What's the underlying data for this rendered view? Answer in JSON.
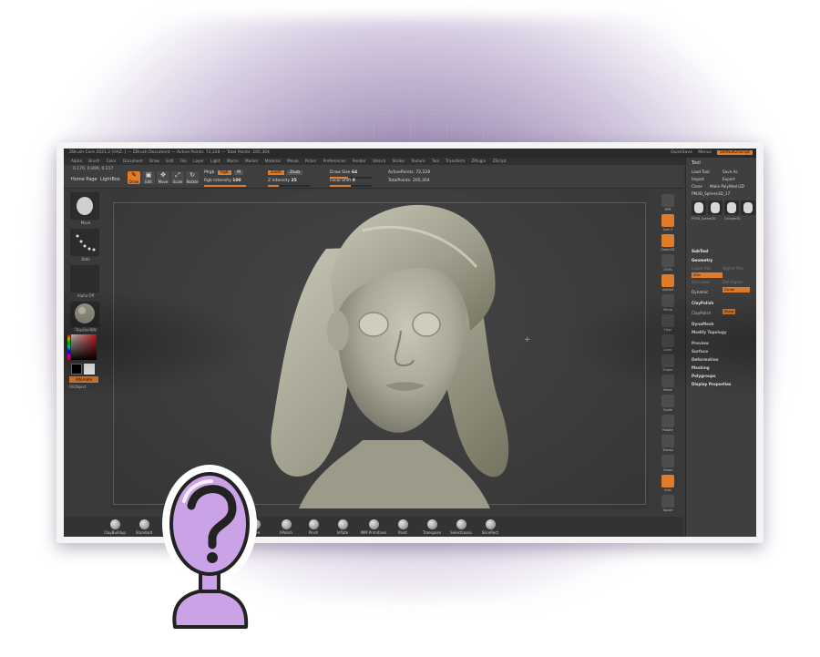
{
  "app": {
    "title_bar": "ZBrush Core 2021.2 [HAZ..] — ZBrush Document — Active Points: 72,228 — Total Points: 205,304",
    "title_right": [
      "QuickSave",
      "Menus",
      "DefaultZScript"
    ],
    "menu": [
      "Alpha",
      "Brush",
      "Color",
      "Document",
      "Draw",
      "Edit",
      "File",
      "Layer",
      "Light",
      "Macro",
      "Marker",
      "Material",
      "Movie",
      "Picker",
      "Preferences",
      "Render",
      "Stencil",
      "Stroke",
      "Texture",
      "Tool",
      "Transform",
      "ZPlugin",
      "ZScript"
    ]
  },
  "toolbar": {
    "coordinates": "0.176, 0.899, 0.217",
    "home_page": "Home Page",
    "lightbox": "LightBox",
    "buttons": [
      "Draw",
      "Edit",
      "Move",
      "Scale",
      "Rotate"
    ],
    "mrgb": "Mrgb",
    "rgb": "Rgb",
    "m": "M",
    "rgb_intensity_label": "Rgb Intensity",
    "rgb_intensity_value": "100",
    "zadd": "Zadd",
    "zsub": "Zsub",
    "z_intensity_label": "Z Intensity",
    "z_intensity_value": "25",
    "draw_size_label": "Draw Size",
    "draw_size_value": "64",
    "focal_shift_label": "Focal Shift",
    "focal_shift_value": "0",
    "active_points": "ActivePoints: 72,228",
    "total_points": "TotalPoints: 205,304"
  },
  "left_shelf": {
    "brush_label": "Move",
    "stroke_label": "Dots",
    "alpha_label": "Alpha Off",
    "texture_label": "Texture Off",
    "material_label": "Clay BuildUp",
    "alternate": "Alternate",
    "fill": "FillObject"
  },
  "right_shelf": [
    "BPR",
    "Spix 3",
    "Zoom2D",
    "100%",
    "AAHalf",
    "Persp",
    "Floor",
    "Local",
    "Frame",
    "Move",
    "Scale",
    "Rotate",
    "Transp",
    "Ghost",
    "Solo",
    "Xpose"
  ],
  "palette": {
    "title": "Tool",
    "load_tool": "Load Tool",
    "save_as": "Save As",
    "import": "Import",
    "export": "Export",
    "clone": "Clone",
    "make_polymesh": "Make PolyMesh3D",
    "current_tool": "PM3D_Sphere3D_17",
    "thumbs": [
      "PM3D_Sphere3D",
      "PM3D_Sphere3D",
      "Cylinder3D",
      "Cylinder3D_1",
      "PM3D_Cylinder3D"
    ],
    "subtool": "SubTool",
    "geometry": "Geometry",
    "lower_res": "Lower Res",
    "higher_res": "Higher Res",
    "sdiv": "SDiv",
    "del_lower": "Del Lower",
    "del_higher": "Del Higher",
    "dynamic": "Dynamic",
    "smt": "Smt",
    "divide": "Divide",
    "claypolish": "ClayPolish",
    "claypolish_btn": "ClayPolish",
    "sharp": "Sharp",
    "dynamesh": "DynaMesh",
    "modify_topology": "Modify Topology",
    "sections": [
      "Preview",
      "Surface",
      "Deformation",
      "Masking",
      "Polygroups",
      "Display Properties"
    ]
  },
  "bottom_shelf": [
    "ClayBuildup",
    "Standard",
    "DamStandard",
    "Move",
    "hPolish",
    "Pinch",
    "Inflate",
    "IMM Primitives",
    "Paint",
    "Transpose",
    "SelectLasso",
    "SliceRect"
  ],
  "colors": {
    "accent": "#e07b2a",
    "panel": "#3a3a3a",
    "clay": "#b9b8a8",
    "mascot_purple": "#caa3e6"
  }
}
